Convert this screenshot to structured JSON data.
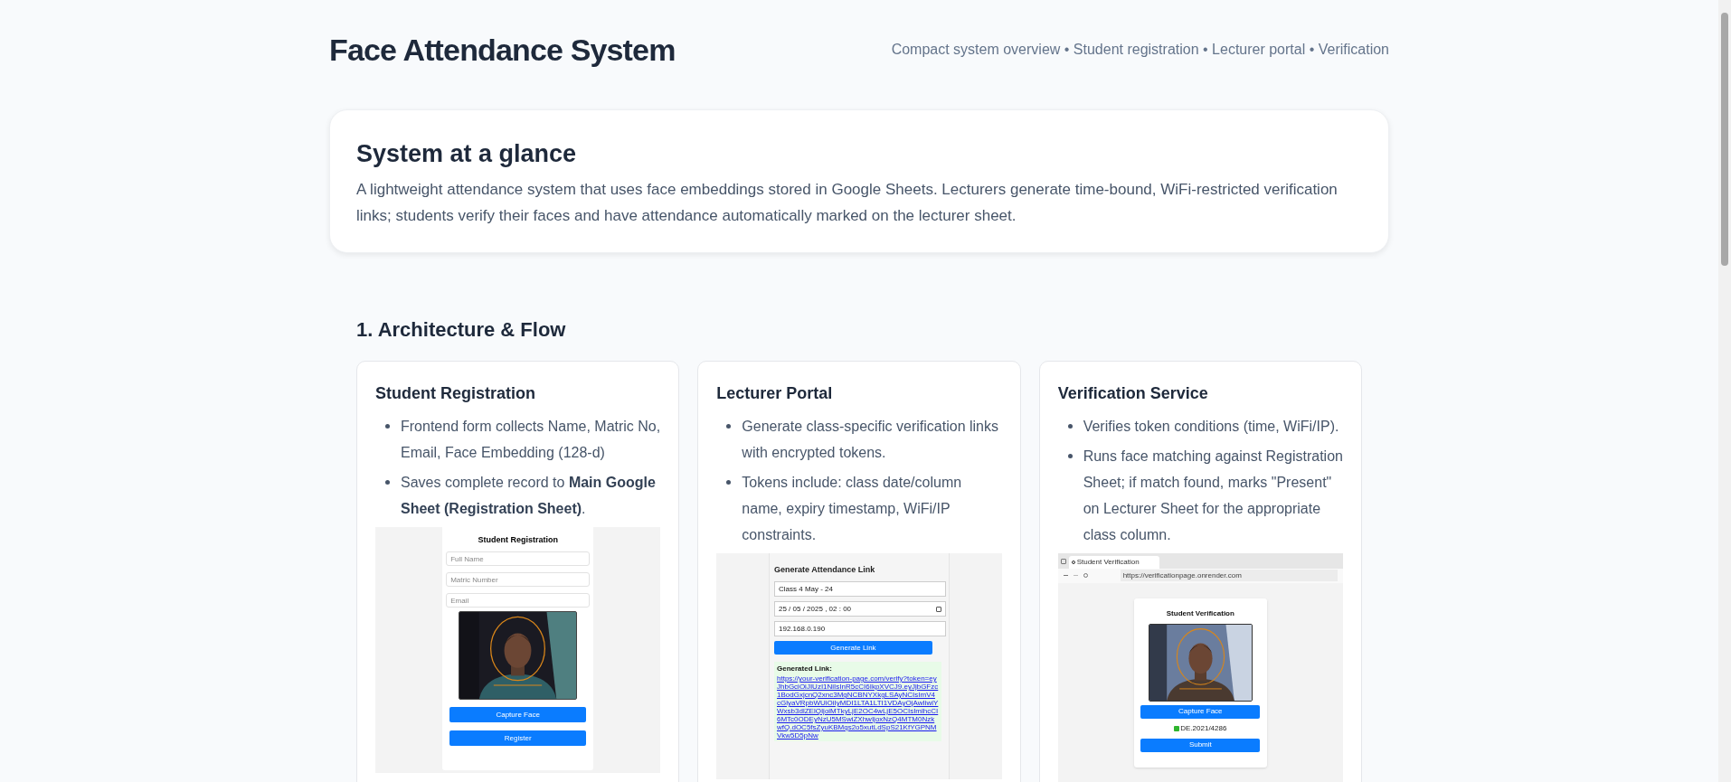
{
  "header": {
    "title": "Face Attendance System",
    "subtitle": "Compact system overview • Student registration • Lecturer portal • Verification"
  },
  "overview": {
    "title": "System at a glance",
    "text": "A lightweight attendance system that uses face embeddings stored in Google Sheets. Lecturers generate time-bound, WiFi-restricted verification links; students verify their faces and have attendance automatically marked on the lecturer sheet."
  },
  "section": {
    "title": "1. Architecture & Flow",
    "cards": [
      {
        "kind": "registration",
        "title": "Student Registration",
        "bullets": [
          "Frontend form collects Name, Matric No, Email, Face Embedding (128-d)",
          "Saves complete record to **Main Google Sheet (Registration Sheet)**."
        ],
        "screenshot": {
          "title": "Student Registration",
          "fields": [
            {
              "placeholder": "Full Name"
            },
            {
              "placeholder": "Matric Number"
            },
            {
              "placeholder": "Email"
            }
          ],
          "camera": {
            "kind": "picture"
          },
          "buttons": [
            "Capture Face",
            "Register"
          ]
        }
      },
      {
        "kind": "lecturer",
        "title": "Lecturer Portal",
        "bullets": [
          "Generate class-specific verification links with encrypted tokens.",
          "Tokens include: class date/column name, expiry timestamp, WiFi/IP constraints."
        ],
        "screenshot": {
          "title": "Generate Attendance Link",
          "fields": [
            {
              "kind": "text",
              "value": "Class 4 May - 24"
            },
            {
              "kind": "date",
              "value": "25 / 05 / 2025 ,  02 : 00"
            },
            {
              "kind": "text",
              "value": "192.168.0.190"
            }
          ],
          "buttons": [
            "Generate Link"
          ],
          "result": {
            "label": "Generated Link:",
            "link": "https://your-verification-page.com/verify?token=eyJhbGciOiJIUzI1NiIsInR5cCI6IkpXVCJ9.eyJjbGFzc1BodGxjcnQ2xnc3MgNCBNYXkgLSAyNCIsImV4cGlyaVRpbWUiOiIyMDI1LTA1LTI1VDAyOjAwIiwiYWxsb3dlZElQIjoiMTkyLjE2OC4wLjE5OCIsImlhcCI6MTc0ODEyNzU5MSwiZXhwIjoxNzQ4MTM0NzkwfQ.dOC5fsZyuKBMqs2o5xutLdSpS21KfYGPNMVkw5D5pNw"
          }
        }
      },
      {
        "kind": "verification",
        "title": "Verification Service",
        "bullets": [
          "Verifies token conditions (time, WiFi/IP).",
          "Runs face matching against Registration Sheet; if match found, marks \"Present\" on Lecturer Sheet for the appropriate class column."
        ],
        "screenshot": {
          "tab": "Student Verification",
          "url": "https://verificationpage.onrender.com",
          "title": "Student Verification",
          "camera": {
            "kind": "picture"
          },
          "buttons": [
            "Capture Face",
            "Submit"
          ],
          "status": "DE.2021/4286"
        }
      }
    ]
  }
}
